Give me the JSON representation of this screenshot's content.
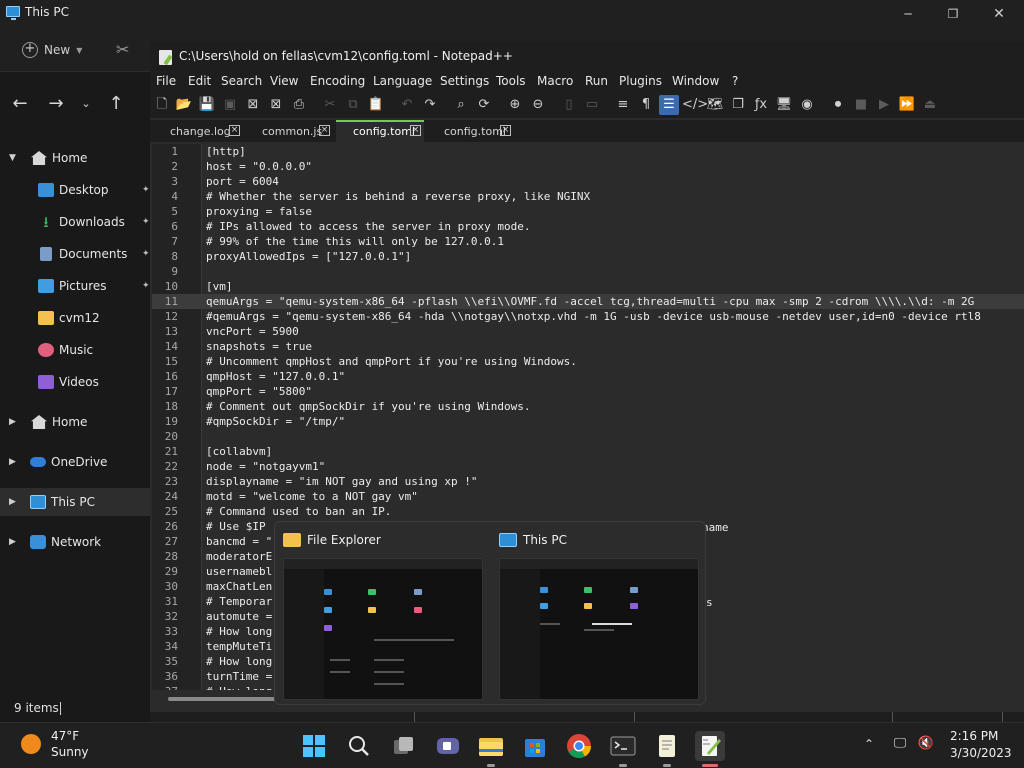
{
  "explorer": {
    "title": "This PC",
    "window_controls": {
      "minimize": "─",
      "maximize": "❐",
      "close": "✕"
    },
    "new_button": "New",
    "nav": {
      "back": "←",
      "forward": "→",
      "recent": "⌄",
      "up": "↑"
    },
    "sidebar": [
      {
        "label": "Home",
        "icon": "home-icon",
        "expanded": true
      },
      {
        "label": "Desktop",
        "icon": "desktop-icon",
        "pinned": true
      },
      {
        "label": "Downloads",
        "icon": "download-icon",
        "pinned": true
      },
      {
        "label": "Documents",
        "icon": "document-icon",
        "pinned": true
      },
      {
        "label": "Pictures",
        "icon": "pictures-icon",
        "pinned": true
      },
      {
        "label": "cvm12",
        "icon": "folder-icon"
      },
      {
        "label": "Music",
        "icon": "music-icon"
      },
      {
        "label": "Videos",
        "icon": "videos-icon"
      },
      {
        "label": "Home",
        "icon": "home-icon"
      },
      {
        "label": "OneDrive",
        "icon": "cloud-icon"
      },
      {
        "label": "This PC",
        "icon": "computer-icon",
        "selected": true
      },
      {
        "label": "Network",
        "icon": "network-icon"
      }
    ],
    "status": "9 items"
  },
  "notepad": {
    "title": "C:\\Users\\hold on fellas\\cvm12\\config.toml - Notepad++",
    "menu": [
      "File",
      "Edit",
      "Search",
      "View",
      "Encoding",
      "Language",
      "Settings",
      "Tools",
      "Macro",
      "Run",
      "Plugins",
      "Window",
      "?"
    ],
    "tabs": [
      {
        "label": "change.log",
        "active": false
      },
      {
        "label": "common.js",
        "active": false
      },
      {
        "label": "config.toml",
        "active": true
      },
      {
        "label": "config.toml",
        "active": false
      }
    ],
    "current_line": 11,
    "lines": [
      "[http]",
      "host = \"0.0.0.0\"",
      "port = 6004",
      "# Whether the server is behind a reverse proxy, like NGINX",
      "proxying = false",
      "# IPs allowed to access the server in proxy mode.",
      "# 99% of the time this will only be 127.0.0.1",
      "proxyAllowedIps = [\"127.0.0.1\"]",
      "",
      "[vm]",
      "qemuArgs = \"qemu-system-x86_64 -pflash \\\\efi\\\\OVMF.fd -accel tcg,thread=multi -cpu max -smp 2 -cdrom \\\\\\\\.\\\\d: -m 2G",
      "#qemuArgs = \"qemu-system-x86_64 -hda \\\\notgay\\\\notxp.vhd -m 1G -usb -device usb-mouse -netdev user,id=n0 -device rtl8",
      "vncPort = 5900",
      "snapshots = true",
      "# Uncomment qmpHost and qmpPort if you're using Windows.",
      "qmpHost = \"127.0.0.1\"",
      "qmpPort = \"5800\"",
      "# Comment out qmpSockDir if you're using Windows.",
      "#qmpSockDir = \"/tmp/\"",
      "",
      "[collabvm]",
      "node = \"notgayvm1\"",
      "displayname = \"im NOT gay and using xp !\"",
      "motd = \"welcome to a NOT gay vm\"",
      "# Command used to ban an IP.",
      "# Use $IP",
      "bancmd = \"",
      "moderatorE",
      "usernamebl",
      "maxChatLen",
      "# Temporar",
      "automute =",
      "# How long",
      "tempMuteTi",
      "# How long",
      "turnTime =",
      "# How long"
    ],
    "line_27_tail": "name",
    "line_33_tail": "s"
  },
  "preview": {
    "cards": [
      {
        "title": "File Explorer",
        "icon": "folder-icon"
      },
      {
        "title": "This PC",
        "icon": "computer-icon"
      }
    ]
  },
  "taskbar": {
    "weather_temp": "47°F",
    "weather_cond": "Sunny",
    "apps": [
      "start-icon",
      "search-icon",
      "task-view-icon",
      "teams-icon",
      "file-explorer-icon",
      "store-icon",
      "chrome-icon",
      "terminal-icon",
      "notepad-icon",
      "notepadpp-icon"
    ],
    "tray_up": "⌃",
    "time": "2:16 PM",
    "date": "3/30/2023"
  }
}
